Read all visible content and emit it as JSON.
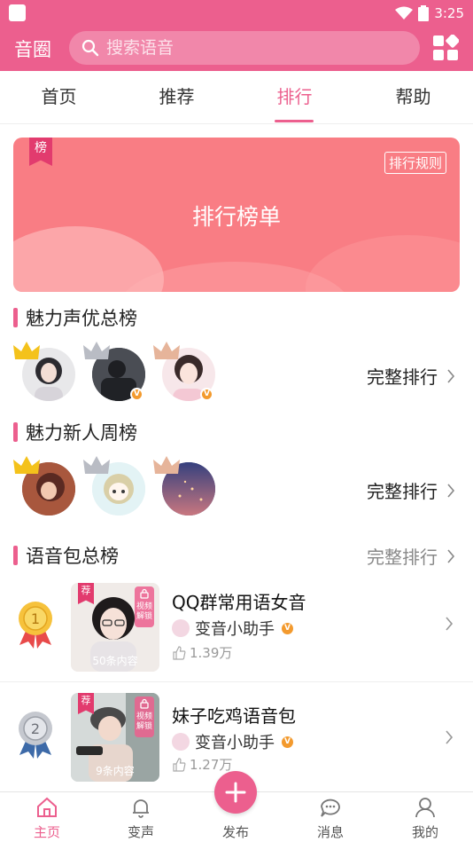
{
  "statusbar": {
    "time": "3:25"
  },
  "appbar": {
    "title": "音圈",
    "search_placeholder": "搜索语音"
  },
  "tabs": [
    {
      "label": "首页"
    },
    {
      "label": "推荐"
    },
    {
      "label": "排行",
      "active": true
    },
    {
      "label": "帮助"
    }
  ],
  "banner": {
    "flag": "榜",
    "title": "排行榜单",
    "rules_label": "排行规则"
  },
  "sections": {
    "charm_voice": {
      "title": "魅力声优总榜",
      "more_label": "完整排行"
    },
    "charm_newcomer": {
      "title": "魅力新人周榜",
      "more_label": "完整排行"
    },
    "voice_pack": {
      "title": "语音包总榜",
      "more_label": "完整排行"
    }
  },
  "voice_packs": [
    {
      "rank": "1",
      "flag": "荐",
      "lock_label": "视频解锁",
      "content_count": "50条内容",
      "name": "QQ群常用语女音",
      "author": "变音小助手",
      "likes": "1.39万"
    },
    {
      "rank": "2",
      "flag": "荐",
      "lock_label": "视频解锁",
      "content_count": "9条内容",
      "name": "妹子吃鸡语音包",
      "author": "变音小助手",
      "likes": "1.27万"
    }
  ],
  "bottomnav": [
    {
      "label": "主页",
      "icon": "home-icon",
      "active": true
    },
    {
      "label": "变声",
      "icon": "bell-icon"
    },
    {
      "label": "发布",
      "icon": "plus-icon"
    },
    {
      "label": "消息",
      "icon": "chat-icon"
    },
    {
      "label": "我的",
      "icon": "user-icon"
    }
  ],
  "colors": {
    "accent": "#ec5f8e",
    "banner": "#f97d84",
    "gold": "#f4c21b",
    "silver": "#b9bcc4",
    "bronze": "#e6b49a",
    "verified": "#f39a2e"
  }
}
